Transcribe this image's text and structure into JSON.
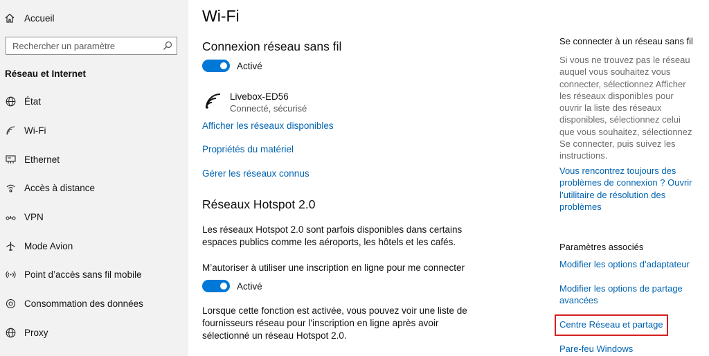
{
  "sidebar": {
    "home_label": "Accueil",
    "search_placeholder": "Rechercher un paramètre",
    "section_title": "Réseau et Internet",
    "items": [
      {
        "label": "État",
        "icon": "globe-icon"
      },
      {
        "label": "Wi-Fi",
        "icon": "wifi-icon"
      },
      {
        "label": "Ethernet",
        "icon": "ethernet-icon"
      },
      {
        "label": "Accès à distance",
        "icon": "dial-up-icon"
      },
      {
        "label": "VPN",
        "icon": "vpn-icon"
      },
      {
        "label": "Mode Avion",
        "icon": "airplane-icon"
      },
      {
        "label": "Point d’accès sans fil mobile",
        "icon": "hotspot-icon"
      },
      {
        "label": "Consommation des données",
        "icon": "data-usage-icon"
      },
      {
        "label": "Proxy",
        "icon": "globe-icon"
      }
    ]
  },
  "main": {
    "title": "Wi-Fi",
    "wireless_heading": "Connexion réseau sans fil",
    "wireless_toggle_label": "Activé",
    "network_name": "Livebox-ED56",
    "network_status": "Connecté, sécurisé",
    "links": [
      "Afficher les réseaux disponibles",
      "Propriétés du matériel",
      "Gérer les réseaux connus"
    ],
    "hotspot_heading": "Réseaux Hotspot 2.0",
    "hotspot_desc": "Les réseaux Hotspot 2.0 sont parfois disponibles dans certains espaces publics comme les aéroports, les hôtels et les cafés.",
    "hotspot_option": "M’autoriser à utiliser une inscription en ligne pour me connecter",
    "hotspot_toggle_label": "Activé",
    "hotspot_note": "Lorsque cette fonction est activée, vous pouvez voir une liste de fournisseurs réseau pour l’inscription en ligne après avoir sélectionné un réseau Hotspot 2.0."
  },
  "right": {
    "connect_title": "Se connecter à un réseau sans fil",
    "connect_text": "Si vous ne trouvez pas le réseau auquel vous souhaitez vous connecter, sélectionnez Afficher les réseaux disponibles pour ouvrir la liste des réseaux disponibles, sélectionnez celui que vous souhaitez, sélectionnez Se connecter, puis suivez les instructions.",
    "troubleshoot_link": "Vous rencontrez toujours des problèmes de connexion ? Ouvrir l’utilitaire de résolution des problèmes",
    "related_title": "Paramètres associés",
    "related_links": [
      "Modifier les options d’adaptateur",
      "Modifier les options de partage avancées",
      "Centre Réseau et partage",
      "Pare-feu Windows"
    ]
  },
  "colors": {
    "accent": "#0078d7",
    "link": "#0063b1",
    "highlight": "#d61f1f",
    "sidebar_bg": "#f2f2f2"
  }
}
